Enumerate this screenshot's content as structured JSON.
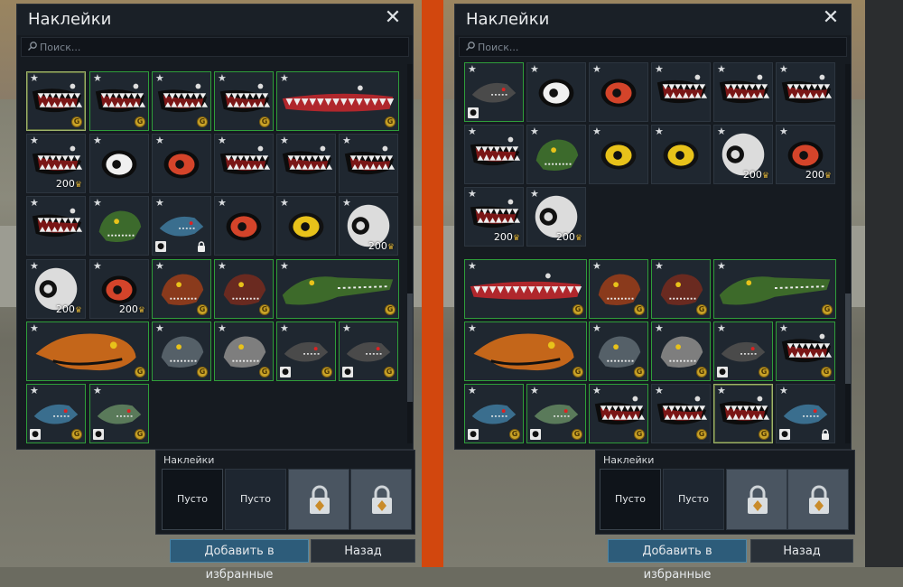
{
  "panels": [
    {
      "title": "Наклейки",
      "search_placeholder": "Поиск...",
      "slots_label": "Наклейки",
      "slots": [
        {
          "label": "Пусто",
          "state": "active"
        },
        {
          "label": "Пусто",
          "state": "empty"
        },
        {
          "label": "",
          "state": "locked"
        },
        {
          "label": "",
          "state": "locked"
        }
      ],
      "favorites_label": "Добавить в избранные",
      "back_label": "Назад"
    },
    {
      "title": "Наклейки",
      "search_placeholder": "Поиск...",
      "slots_label": "Наклейки",
      "slots": [
        {
          "label": "Пусто",
          "state": "active"
        },
        {
          "label": "Пусто",
          "state": "empty"
        },
        {
          "label": "",
          "state": "locked"
        },
        {
          "label": "",
          "state": "locked"
        }
      ],
      "favorites_label": "Добавить в избранные",
      "back_label": "Назад"
    }
  ],
  "decals": {
    "shark_mouth": "shark-mouth-decal",
    "eye": "eye-decal",
    "animal": "animal-head-decal",
    "price_label": "200",
    "star_icon": "star-icon",
    "coin_icon": "golden-eagle-coin-icon",
    "gift_icon": "gift-icon",
    "lock_icon": "lock-icon"
  },
  "colors": {
    "accent_divider": "#d2470e",
    "owned_border": "#2f9e3a",
    "favorites_button": "#2d5c7a",
    "coin": "#c9a227"
  }
}
